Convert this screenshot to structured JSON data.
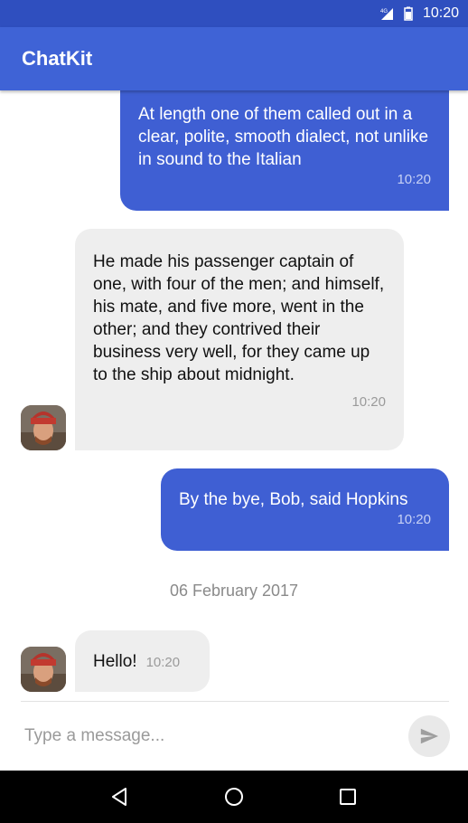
{
  "status_bar": {
    "network": "4G",
    "time": "10:20"
  },
  "app_bar": {
    "title": "ChatKit"
  },
  "messages": [
    {
      "direction": "outgoing",
      "text": "At length one of them called out in a clear, polite, smooth dialect, not unlike in sound to the Italian",
      "time": "10:20"
    },
    {
      "direction": "incoming",
      "text": "He made his passenger captain of one, with four of the men; and himself, his mate, and five more, went in the other; and they contrived their business very well, for they came up to the ship about midnight.",
      "time": "10:20"
    },
    {
      "direction": "outgoing",
      "text": "By the bye, Bob, said Hopkins",
      "time": "10:20"
    },
    {
      "direction": "incoming",
      "text": "Hello!",
      "time": "10:20"
    }
  ],
  "date_separator": "06 February 2017",
  "composer": {
    "placeholder": "Type a message..."
  },
  "colors": {
    "status_bar": "#2f4fbf",
    "app_bar": "#3f63d6",
    "outgoing_bubble": "#3f5fd3",
    "incoming_bubble": "#eeeeee"
  }
}
